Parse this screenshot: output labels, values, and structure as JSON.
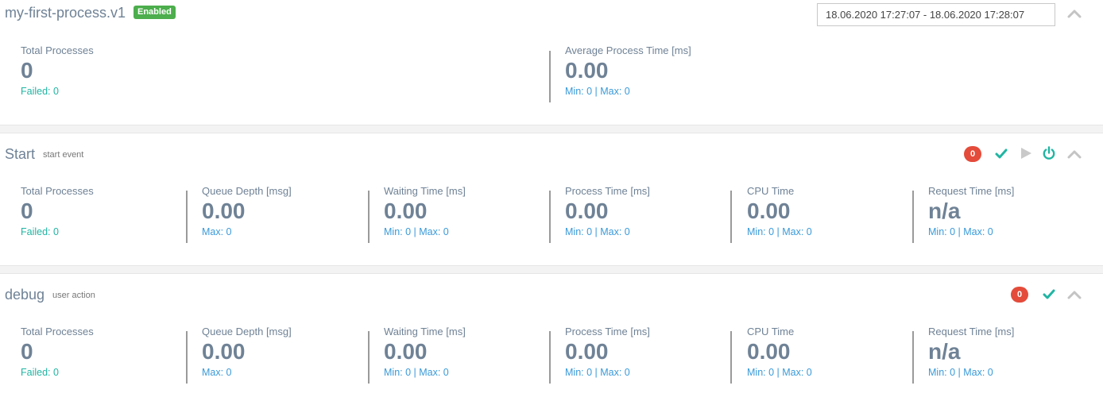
{
  "process": {
    "title": "my-first-process.v1",
    "status": "Enabled",
    "date_range": "18.06.2020 17:27:07 - 18.06.2020 17:28:07",
    "stats": [
      {
        "label": "Total Processes",
        "value": "0",
        "sub": "Failed: 0"
      },
      {
        "label": "Average Process Time [ms]",
        "value": "0.00",
        "sub": "Min: 0 | Max: 0"
      }
    ]
  },
  "steps": [
    {
      "title": "Start",
      "subtitle": "start event",
      "error_count": "0",
      "icons": [
        "check-icon",
        "play-icon",
        "power-icon",
        "chevron-up-icon"
      ],
      "stats": [
        {
          "label": "Total Processes",
          "value": "0",
          "sub": "Failed: 0"
        },
        {
          "label": "Queue Depth [msg]",
          "value": "0.00",
          "sub": "Max: 0"
        },
        {
          "label": "Waiting Time [ms]",
          "value": "0.00",
          "sub": "Min: 0 | Max: 0"
        },
        {
          "label": "Process Time [ms]",
          "value": "0.00",
          "sub": "Min: 0 | Max: 0"
        },
        {
          "label": "CPU Time",
          "value": "0.00",
          "sub": "Min: 0 | Max: 0"
        },
        {
          "label": "Request Time [ms]",
          "value": "n/a",
          "sub": "Min: 0 | Max: 0"
        }
      ]
    },
    {
      "title": "debug",
      "subtitle": "user action",
      "error_count": "0",
      "icons": [
        "check-icon",
        "chevron-up-icon"
      ],
      "stats": [
        {
          "label": "Total Processes",
          "value": "0",
          "sub": "Failed: 0"
        },
        {
          "label": "Queue Depth [msg]",
          "value": "0.00",
          "sub": "Max: 0"
        },
        {
          "label": "Waiting Time [ms]",
          "value": "0.00",
          "sub": "Min: 0 | Max: 0"
        },
        {
          "label": "Process Time [ms]",
          "value": "0.00",
          "sub": "Min: 0 | Max: 0"
        },
        {
          "label": "CPU Time",
          "value": "0.00",
          "sub": "Min: 0 | Max: 0"
        },
        {
          "label": "Request Time [ms]",
          "value": "n/a",
          "sub": "Min: 0 | Max: 0"
        }
      ]
    }
  ],
  "colors": {
    "enabled_badge": "#4cae4c",
    "error_badge": "#e44b3a",
    "teal": "#21b5a3",
    "link_blue": "#3a9ad9",
    "text": "#6f8296"
  }
}
